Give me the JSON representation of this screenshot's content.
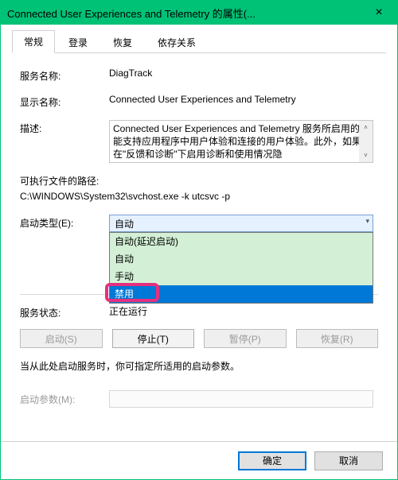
{
  "title": "Connected User Experiences and Telemetry 的属性(...",
  "tabs": [
    "常规",
    "登录",
    "恢复",
    "依存关系"
  ],
  "active_tab": 0,
  "fields": {
    "service_name_label": "服务名称:",
    "service_name_value": "DiagTrack",
    "display_name_label": "显示名称:",
    "display_name_value": "Connected User Experiences and Telemetry",
    "description_label": "描述:",
    "description_value": "Connected User Experiences and Telemetry 服务所启用的功能支持应用程序中用户体验和连接的用户体验。此外，如果在\"反馈和诊断\"下启用诊断和使用情况隐",
    "exe_path_label": "可执行文件的路径:",
    "exe_path_value": "C:\\WINDOWS\\System32\\svchost.exe -k utcsvc -p",
    "startup_type_label": "启动类型(E):",
    "startup_type_value": "自动",
    "startup_type_options": [
      "自动(延迟启动)",
      "自动",
      "手动",
      "禁用"
    ],
    "startup_type_highlight_index": 3,
    "service_status_label": "服务状态:",
    "service_status_value": "正在运行",
    "note": "当从此处启动服务时，你可指定所适用的启动参数。",
    "start_param_label": "启动参数(M):",
    "start_param_value": ""
  },
  "svc_buttons": {
    "start": "启动(S)",
    "stop": "停止(T)",
    "pause": "暂停(P)",
    "resume": "恢复(R)"
  },
  "footer": {
    "ok": "确定",
    "cancel": "取消"
  }
}
